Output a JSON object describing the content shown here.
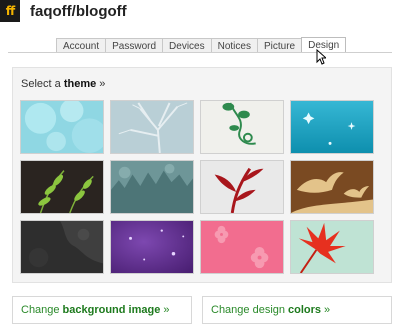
{
  "header": {
    "logo_text": "ff",
    "title": "faqoff/blogoff"
  },
  "tabs": [
    {
      "label": "Account",
      "active": false
    },
    {
      "label": "Password",
      "active": false
    },
    {
      "label": "Devices",
      "active": false
    },
    {
      "label": "Notices",
      "active": false
    },
    {
      "label": "Picture",
      "active": false
    },
    {
      "label": "Design",
      "active": true
    }
  ],
  "theme_panel": {
    "prefix": "Select a",
    "keyword": "theme",
    "suffix": "»",
    "themes": [
      {
        "name": "light-blue-bokeh",
        "colors": [
          "#8fd7e3",
          "#b8eaf0"
        ]
      },
      {
        "name": "grey-blue-tree",
        "colors": [
          "#b9cfd6",
          "#8da7b0"
        ]
      },
      {
        "name": "green-vine-on-white",
        "colors": [
          "#f0f0ec",
          "#2e8a4e"
        ]
      },
      {
        "name": "teal-sparkle",
        "colors": [
          "#1aa3c2",
          "#66d0e4"
        ]
      },
      {
        "name": "green-leaves-on-dark",
        "colors": [
          "#2a2420",
          "#7fb23a"
        ]
      },
      {
        "name": "teal-forest-grunge",
        "colors": [
          "#6e9698",
          "#4d7577"
        ]
      },
      {
        "name": "red-plant-on-grey",
        "colors": [
          "#e9e9e9",
          "#a8161c"
        ]
      },
      {
        "name": "brown-birds",
        "colors": [
          "#7a4a22",
          "#e3c38a"
        ]
      },
      {
        "name": "dark-grey-grunge",
        "colors": [
          "#2e2e2e",
          "#4a4a4a"
        ]
      },
      {
        "name": "purple-sparkle",
        "colors": [
          "#5b2a87",
          "#8e5fc0"
        ]
      },
      {
        "name": "pink-flowers",
        "colors": [
          "#f26d8f",
          "#f79ab1"
        ]
      },
      {
        "name": "red-leaf-on-mint",
        "colors": [
          "#bfe3d4",
          "#e6301f"
        ]
      }
    ]
  },
  "links": {
    "background": {
      "prefix": "Change",
      "keyword": "background image",
      "suffix": "»"
    },
    "colors": {
      "prefix": "Change design",
      "keyword": "colors",
      "suffix": "»"
    }
  }
}
